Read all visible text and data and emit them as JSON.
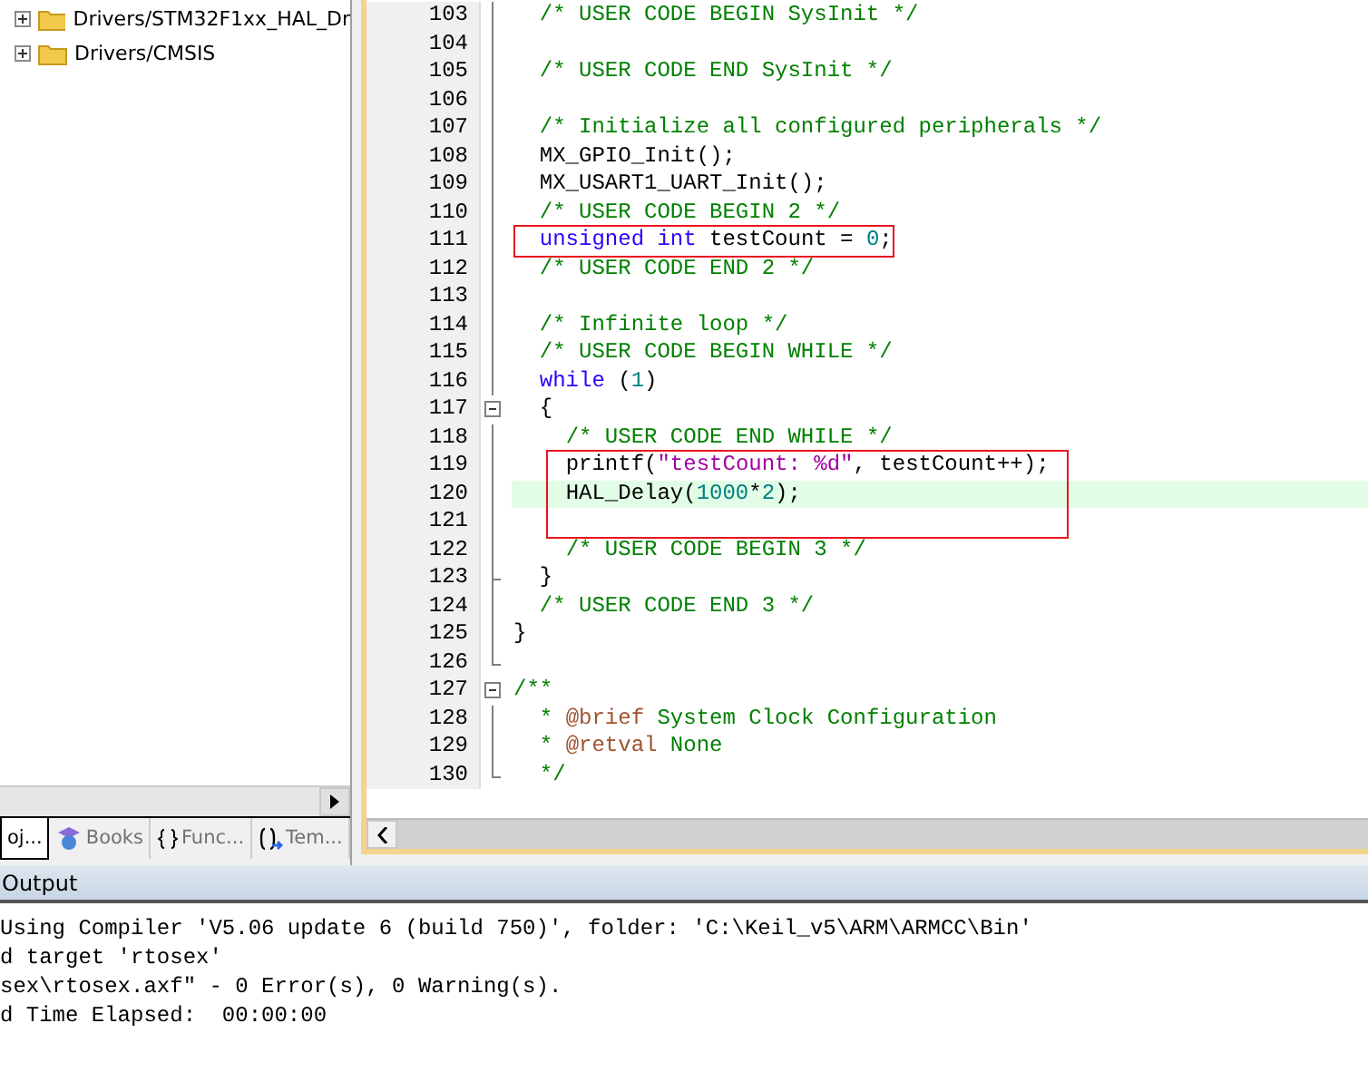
{
  "project_tree": {
    "items": [
      {
        "label": "Drivers/STM32F1xx_HAL_Dr",
        "expanded": false
      },
      {
        "label": "Drivers/CMSIS",
        "expanded": false
      }
    ]
  },
  "panel_tabs": [
    {
      "label": "oj...",
      "kind": "project",
      "selected": true
    },
    {
      "label": "Books",
      "kind": "books",
      "selected": false
    },
    {
      "label": "Func...",
      "kind": "functions",
      "selected": false
    },
    {
      "label": "Tem...",
      "kind": "templates",
      "selected": false
    }
  ],
  "editor": {
    "lines": [
      {
        "number": "103",
        "kind": "line",
        "boxed": false,
        "current": false,
        "tokens": [
          {
            "kind": "comment",
            "text": "  /* USER CODE BEGIN SysInit */"
          }
        ]
      },
      {
        "number": "104",
        "kind": "line",
        "boxed": false,
        "current": false
      },
      {
        "number": "105",
        "kind": "line",
        "boxed": false,
        "current": false,
        "tokens": [
          {
            "kind": "comment",
            "text": "  /* USER CODE END SysInit */"
          }
        ]
      },
      {
        "number": "106",
        "kind": "line",
        "boxed": false,
        "current": false
      },
      {
        "number": "107",
        "kind": "line",
        "boxed": false,
        "current": false,
        "tokens": [
          {
            "kind": "comment",
            "text": "  /* Initialize all configured peripherals */"
          }
        ]
      },
      {
        "number": "108",
        "kind": "line",
        "boxed": false,
        "current": false,
        "tokens": [
          {
            "kind": "plain",
            "text": "  MX_GPIO_Init();"
          }
        ]
      },
      {
        "number": "109",
        "kind": "line",
        "boxed": false,
        "current": false,
        "tokens": [
          {
            "kind": "plain",
            "text": "  MX_USART1_UART_Init();"
          }
        ]
      },
      {
        "number": "110",
        "kind": "line",
        "boxed": false,
        "current": false,
        "tokens": [
          {
            "kind": "comment",
            "text": "  /* USER CODE BEGIN 2 */"
          }
        ]
      },
      {
        "number": "111",
        "kind": "line",
        "boxed": true,
        "current": false,
        "tokens": [
          {
            "kind": "keyword",
            "text": "  unsigned int"
          },
          {
            "kind": "plain",
            "text": " testCount = "
          },
          {
            "kind": "number",
            "text": "0"
          },
          {
            "kind": "plain",
            "text": ";"
          }
        ]
      },
      {
        "number": "112",
        "kind": "line",
        "boxed": false,
        "current": false,
        "tokens": [
          {
            "kind": "comment",
            "text": "  /* USER CODE END 2 */"
          }
        ]
      },
      {
        "number": "113",
        "kind": "line",
        "boxed": false,
        "current": false
      },
      {
        "number": "114",
        "kind": "line",
        "boxed": false,
        "current": false,
        "tokens": [
          {
            "kind": "comment",
            "text": "  /* Infinite loop */"
          }
        ]
      },
      {
        "number": "115",
        "kind": "line",
        "boxed": false,
        "current": false,
        "tokens": [
          {
            "kind": "comment",
            "text": "  /* USER CODE BEGIN WHILE */"
          }
        ]
      },
      {
        "number": "116",
        "kind": "line",
        "boxed": false,
        "current": false,
        "tokens": [
          {
            "kind": "keyword",
            "text": "  while"
          },
          {
            "kind": "plain",
            "text": " ("
          },
          {
            "kind": "number",
            "text": "1"
          },
          {
            "kind": "plain",
            "text": ")"
          }
        ]
      },
      {
        "number": "117",
        "kind": "fold_open",
        "boxed": false,
        "current": false,
        "tokens": [
          {
            "kind": "plain",
            "text": "  {"
          }
        ]
      },
      {
        "number": "118",
        "kind": "line",
        "boxed": false,
        "current": false,
        "tokens": [
          {
            "kind": "comment",
            "text": "    /* USER CODE END WHILE */"
          }
        ]
      },
      {
        "number": "119",
        "kind": "line",
        "boxed": true,
        "current": false,
        "tokens": [
          {
            "kind": "plain",
            "text": "    printf("
          },
          {
            "kind": "string",
            "text": "\"testCount: %d\""
          },
          {
            "kind": "plain",
            "text": ", testCount++);"
          }
        ]
      },
      {
        "number": "120",
        "kind": "line",
        "boxed": true,
        "current": true,
        "tokens": [
          {
            "kind": "plain",
            "text": "    HAL_Delay("
          },
          {
            "kind": "number",
            "text": "1000"
          },
          {
            "kind": "plain",
            "text": "*"
          },
          {
            "kind": "number",
            "text": "2"
          },
          {
            "kind": "plain",
            "text": ");"
          }
        ]
      },
      {
        "number": "121",
        "kind": "line",
        "boxed": true,
        "current": false
      },
      {
        "number": "122",
        "kind": "line",
        "boxed": false,
        "current": false,
        "tokens": [
          {
            "kind": "comment",
            "text": "    /* USER CODE BEGIN 3 */"
          }
        ]
      },
      {
        "number": "123",
        "kind": "fold_tick",
        "boxed": false,
        "current": false,
        "tokens": [
          {
            "kind": "plain",
            "text": "  }"
          }
        ]
      },
      {
        "number": "124",
        "kind": "line",
        "boxed": false,
        "current": false,
        "tokens": [
          {
            "kind": "comment",
            "text": "  /* USER CODE END 3 */"
          }
        ]
      },
      {
        "number": "125",
        "kind": "line",
        "boxed": false,
        "current": false,
        "tokens": [
          {
            "kind": "plain",
            "text": "}"
          }
        ]
      },
      {
        "number": "126",
        "kind": "fold_end",
        "boxed": false,
        "current": false
      },
      {
        "number": "127",
        "kind": "fold_open",
        "boxed": false,
        "current": false,
        "tokens": [
          {
            "kind": "comment",
            "text": "/**"
          }
        ]
      },
      {
        "number": "128",
        "kind": "line",
        "boxed": false,
        "current": false,
        "tokens": [
          {
            "kind": "comment",
            "text": "  * "
          },
          {
            "kind": "doc_tag",
            "text": "@brief"
          },
          {
            "kind": "comment",
            "text": " System Clock Configuration"
          }
        ]
      },
      {
        "number": "129",
        "kind": "line",
        "boxed": false,
        "current": false,
        "tokens": [
          {
            "kind": "comment",
            "text": "  * "
          },
          {
            "kind": "doc_tag",
            "text": "@retval"
          },
          {
            "kind": "comment",
            "text": " None"
          }
        ]
      },
      {
        "number": "130",
        "kind": "fold_end",
        "boxed": false,
        "current": false,
        "tokens": [
          {
            "kind": "comment",
            "text": "  */"
          }
        ]
      }
    ]
  },
  "output": {
    "title": "Output",
    "lines": [
      "Using Compiler 'V5.06 update 6 (build 750)', folder: 'C:\\Keil_v5\\ARM\\ARMCC\\Bin'",
      "d target 'rtosex'",
      "sex\\rtosex.axf\" - 0 Error(s), 0 Warning(s).",
      "d Time Elapsed:  00:00:00"
    ]
  }
}
